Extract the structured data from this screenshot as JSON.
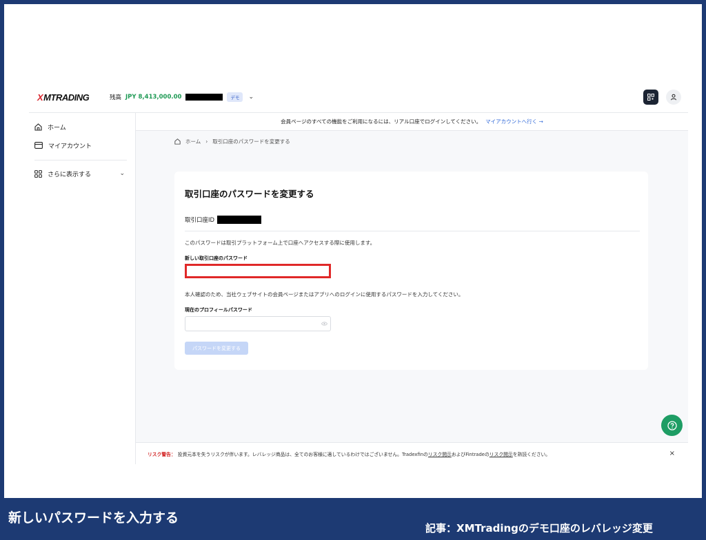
{
  "header": {
    "logo_mark": "X",
    "logo_text": "MTRADING",
    "balance_label": "残高",
    "balance_amount": "JPY 8,413,000.00",
    "demo_badge": "デモ",
    "chevron": "⌄"
  },
  "sidebar": {
    "items": [
      {
        "label": "ホーム",
        "icon": "home-icon"
      },
      {
        "label": "マイアカウント",
        "icon": "card-icon"
      },
      {
        "label": "さらに表示する",
        "icon": "grid-icon"
      }
    ],
    "more_chevron": "⌄"
  },
  "notice": {
    "text": "会員ページのすべての機能をご利用になるには、リアル口座でログインしてください。",
    "link": "マイアカウントへ行く →"
  },
  "breadcrumb": {
    "home": "ホーム",
    "separator": "›",
    "current": "取引口座のパスワードを変更する"
  },
  "form": {
    "title": "取引口座のパスワードを変更する",
    "account_id_label": "取引口座ID",
    "description": "このパスワードは取引プラットフォーム上で口座へアクセスする際に使用します。",
    "new_password_label": "新しい取引口座のパスワード",
    "new_password_value": "",
    "verify_description": "本人確認のため、当社ウェブサイトの会員ページまたはアプリへのログインに使用するパスワードを入力してください。",
    "current_password_label": "現在のプロフィールパスワード",
    "current_password_value": "",
    "submit_label": "パスワードを変更する"
  },
  "risk": {
    "label": "リスク警告：",
    "text_1": "投資元本を失うリスクが伴います。レバレッジ商品は、全てのお客様に適しているわけではございません。Tradexfinの",
    "link_1": "リスク開示",
    "text_2": "およびFintradeの",
    "link_2": "リスク開示",
    "text_3": "を熟読ください。",
    "close": "×"
  },
  "captions": {
    "left": "新しいパスワードを入力する",
    "right": "記事：XMTradingのデモ口座のレバレッジ変更"
  },
  "colors": {
    "accent_green": "#1f9a55",
    "link_blue": "#2c66d8",
    "highlight_red": "#e02828",
    "frame_navy": "#1d3a73"
  }
}
